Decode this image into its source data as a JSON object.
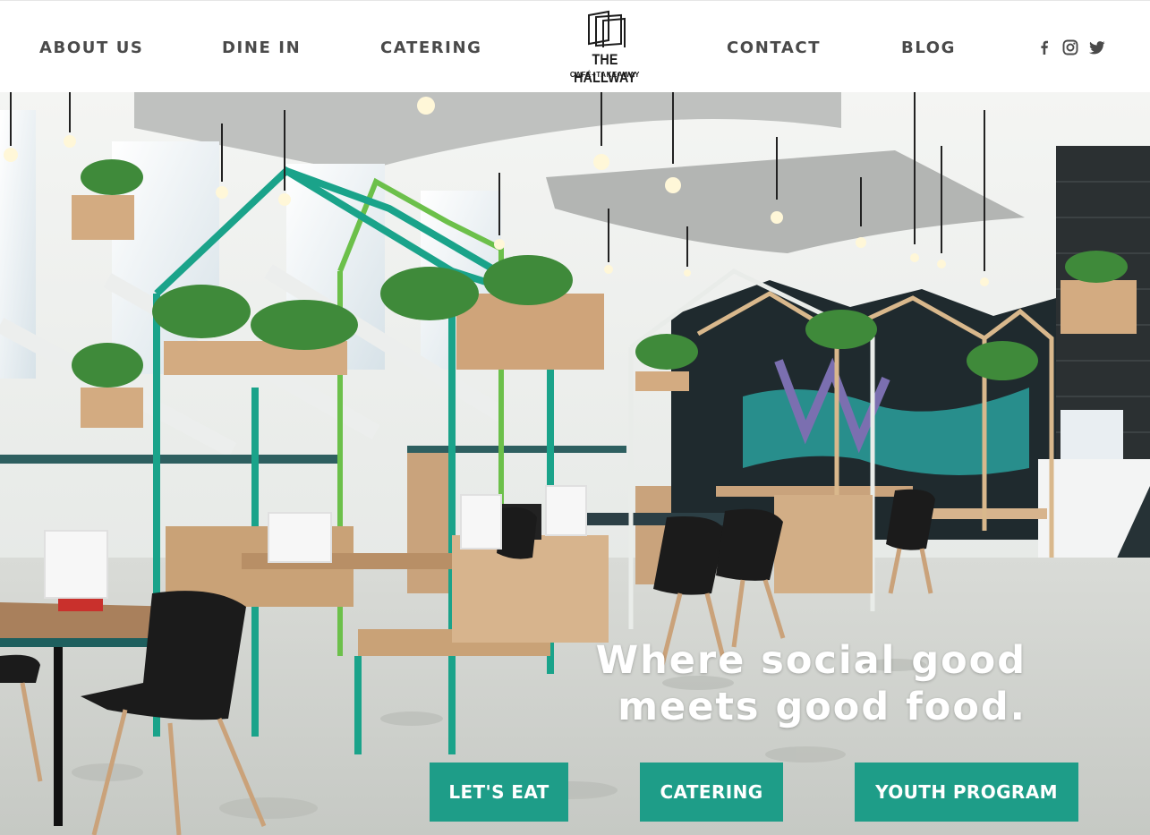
{
  "nav": {
    "about": "ABOUT US",
    "dine_in": "DINE IN",
    "catering": "CATERING",
    "contact": "CONTACT",
    "blog": "BLOG"
  },
  "logo": {
    "name": "THE HALLWAY",
    "tagline": "CAFÉ+TAKEAWAY"
  },
  "social": {
    "icons": [
      "facebook-icon",
      "instagram-icon",
      "twitter-icon"
    ]
  },
  "hero": {
    "headline_line1": "Where social good",
    "headline_line2": "meets good food.",
    "buttons": {
      "lets_eat": "LET'S EAT",
      "catering": "CATERING",
      "youth_program": "YOUTH PROGRAM"
    }
  },
  "colors": {
    "accent": "#1e9d88",
    "nav_text": "#4a4a4a",
    "frame_teal": "#1aa38a",
    "frame_green": "#6cc04a"
  }
}
